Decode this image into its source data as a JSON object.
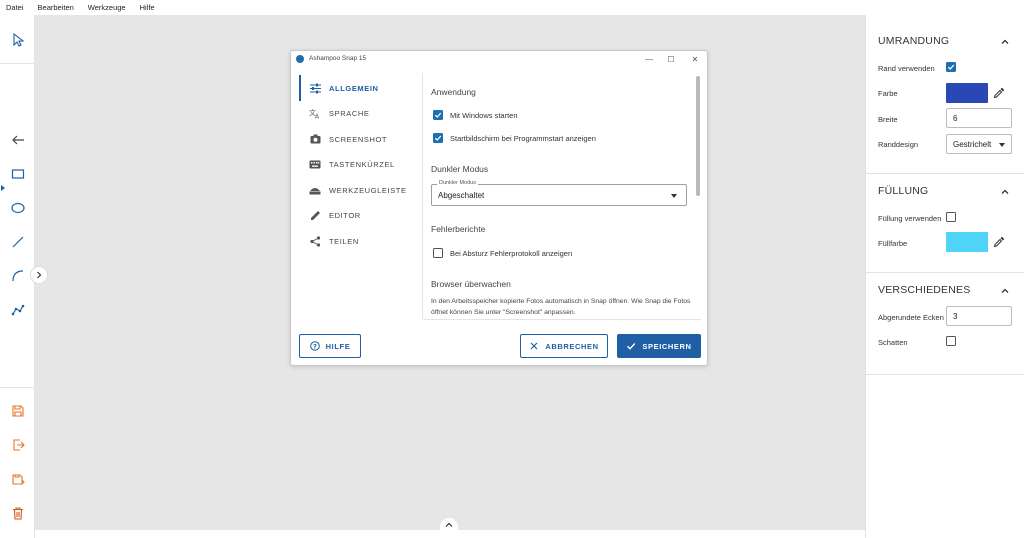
{
  "menu": [
    "Datei",
    "Bearbeiten",
    "Werkzeuge",
    "Hilfe"
  ],
  "dialog": {
    "title": "Ashampoo Snap 15",
    "nav": [
      {
        "label": "ALLGEMEIN",
        "icon": "tune-icon"
      },
      {
        "label": "SPRACHE",
        "icon": "translate-icon"
      },
      {
        "label": "SCREENSHOT",
        "icon": "camera-icon"
      },
      {
        "label": "TASTENKÜRZEL",
        "icon": "keyboard-icon"
      },
      {
        "label": "WERKZEUGLEISTE",
        "icon": "toolbar-icon"
      },
      {
        "label": "EDITOR",
        "icon": "pencil-icon"
      },
      {
        "label": "TEILEN",
        "icon": "share-icon"
      }
    ],
    "content": {
      "anwendung_heading": "Anwendung",
      "opt_windows_start": "Mit Windows starten",
      "opt_startscreen": "Startbildschirm bei Programmstart anzeigen",
      "dark_heading": "Dunkler Modus",
      "dark_select_legend": "Dunkler Modus",
      "dark_select_value": "Abgeschaltet",
      "errors_heading": "Fehlerberichte",
      "opt_error_log": "Bei Absturz Fehlerprotokoll anzeigen",
      "browser_heading": "Browser überwachen",
      "browser_text": "In den Arbeitsspeicher kopierte Fotos automatisch in Snap öffnen. Wie Snap die Fotos öffnet können Sie unter \"Screenshot\" anpassen."
    },
    "buttons": {
      "help": "HILFE",
      "cancel": "ABBRECHEN",
      "save": "SPEICHERN"
    }
  },
  "right_panel": {
    "umrandung": {
      "title": "UMRANDUNG",
      "use_label": "Rand verwenden",
      "color_label": "Farbe",
      "color": "#2a48b5",
      "width_label": "Breite",
      "width_value": "6",
      "design_label": "Randdesign",
      "design_value": "Gestrichelt"
    },
    "fuellung": {
      "title": "FÜLLUNG",
      "use_label": "Füllung verwenden",
      "color_label": "Füllfarbe",
      "color": "#4fd3f7"
    },
    "verschiedenes": {
      "title": "VERSCHIEDENES",
      "corners_label": "Abgerundete Ecken",
      "corners_value": "3",
      "shadow_label": "Schatten"
    }
  },
  "colors": {
    "accent": "#1f5fa6",
    "canvas": "#e6e6e6",
    "tool_orange": "#e8732a",
    "tool_blue": "#1f5fa6"
  }
}
